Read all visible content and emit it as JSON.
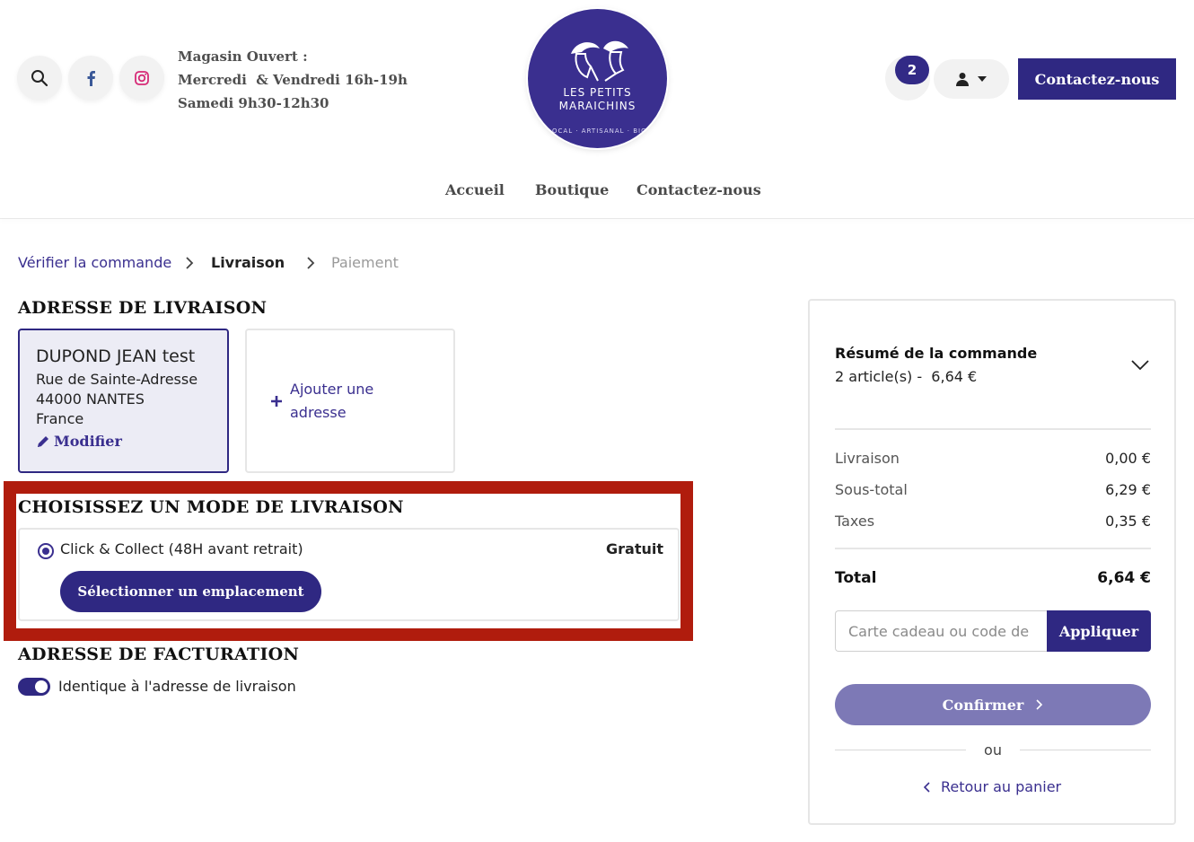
{
  "header": {
    "hours": {
      "title": "Magasin Ouvert :",
      "line1": "Mercredi  & Vendredi 16h-19h",
      "line2": "Samedi 9h30-12h30"
    },
    "logo": {
      "line1": "LES PETITS",
      "line2": "MARAICHINS",
      "sub": "LOCAL · ARTISANAL · BIO"
    },
    "cart_count": "2",
    "contact_button": "Contactez-nous",
    "nav": [
      "Accueil",
      "Boutique",
      "Contactez-nous"
    ]
  },
  "breadcrumb": {
    "step1": "Vérifier la commande",
    "step2": "Livraison",
    "step3": "Paiement"
  },
  "shipping_address": {
    "title": "ADRESSE DE LIVRAISON",
    "name": "DUPOND JEAN test",
    "street": "Rue de Sainte-Adresse",
    "city": "44000 NANTES",
    "country": "France",
    "modify_label": "Modifier",
    "add_label_1": "Ajouter une",
    "add_label_2": "adresse"
  },
  "delivery": {
    "title": "CHOISISSEZ UN MODE DE LIVRAISON",
    "option_label": "Click & Collect (48H avant retrait)",
    "option_price": "Gratuit",
    "select_button": "Sélectionner un emplacement"
  },
  "billing": {
    "title": "ADRESSE DE FACTURATION",
    "same_label": "Identique à l'adresse de livraison"
  },
  "summary": {
    "title": "Résumé de la commande",
    "subtitle": "2 article(s) -  6,64 €",
    "rows": [
      {
        "label": "Livraison",
        "value": "0,00 €"
      },
      {
        "label": "Sous-total",
        "value": "6,29 €"
      },
      {
        "label": "Taxes",
        "value": "0,35 €"
      }
    ],
    "total_label": "Total",
    "total_value": "6,64 €",
    "coupon_placeholder": "Carte cadeau ou code de",
    "apply_button": "Appliquer",
    "confirm_button": "Confirmer",
    "or_label": "ou",
    "back_link": "Retour au panier"
  },
  "colors": {
    "brand": "#2f2882",
    "highlight": "#b01c0d",
    "confirm_disabled": "#7d79b6"
  }
}
